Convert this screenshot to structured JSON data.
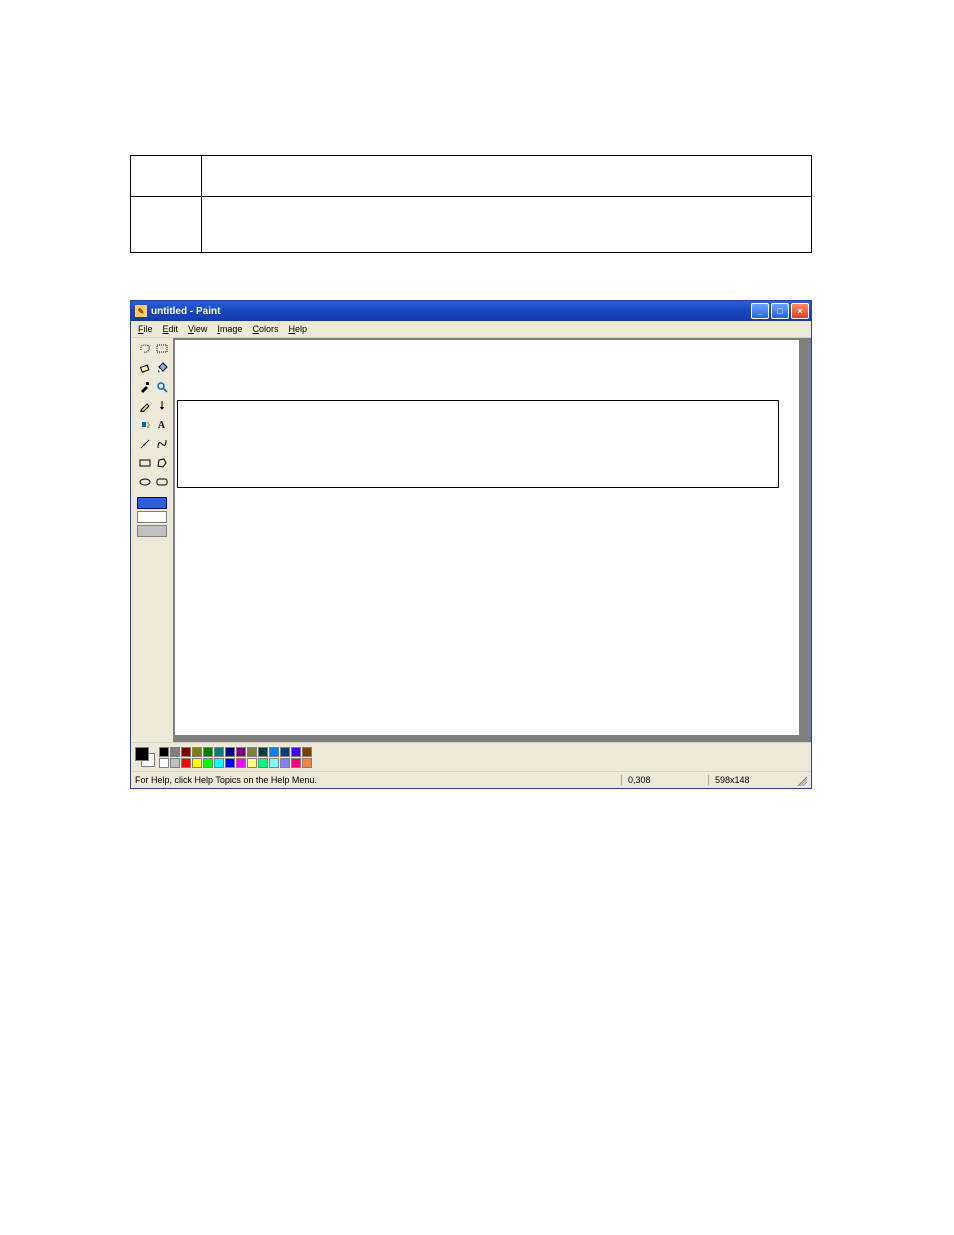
{
  "window": {
    "title": "untitled - Paint"
  },
  "menu": {
    "file": "File",
    "edit": "Edit",
    "view": "View",
    "image": "Image",
    "colors": "Colors",
    "help": "Help"
  },
  "tools": {
    "freeform_select": "Free-Form Select",
    "rect_select": "Select",
    "eraser": "Eraser",
    "fill": "Fill With Color",
    "picker": "Pick Color",
    "magnifier": "Magnifier",
    "pencil": "Pencil",
    "brush": "Brush",
    "airbrush": "Airbrush",
    "text": "Text",
    "line": "Line",
    "curve": "Curve",
    "rectangle": "Rectangle",
    "polygon": "Polygon",
    "ellipse": "Ellipse",
    "rounded_rect": "Rounded Rectangle"
  },
  "palette": {
    "row1": [
      "#000000",
      "#808080",
      "#800000",
      "#808000",
      "#008000",
      "#008080",
      "#000080",
      "#800080",
      "#808040",
      "#004040",
      "#0080ff",
      "#004080",
      "#4000ff",
      "#804000"
    ],
    "row2": [
      "#ffffff",
      "#c0c0c0",
      "#ff0000",
      "#ffff00",
      "#00ff00",
      "#00ffff",
      "#0000ff",
      "#ff00ff",
      "#ffff80",
      "#00ff80",
      "#80ffff",
      "#8080ff",
      "#ff0080",
      "#ff8040"
    ]
  },
  "status": {
    "help": "For Help, click Help Topics on the Help Menu.",
    "coords": "0,308",
    "canvas_size": "598x148"
  }
}
